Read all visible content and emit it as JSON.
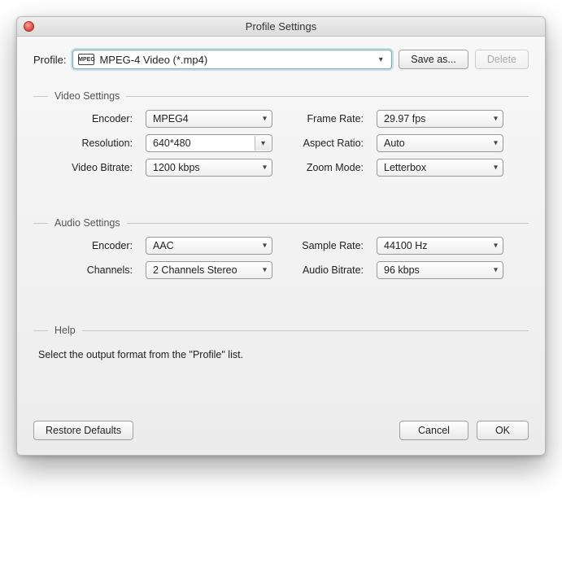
{
  "title": "Profile Settings",
  "profile": {
    "label": "Profile:",
    "icon_text": "MPEG",
    "value": "MPEG-4 Video (*.mp4)",
    "save_as": "Save as...",
    "delete": "Delete"
  },
  "video": {
    "legend": "Video Settings",
    "encoder_label": "Encoder:",
    "encoder": "MPEG4",
    "resolution_label": "Resolution:",
    "resolution": "640*480",
    "bitrate_label": "Video Bitrate:",
    "bitrate": "1200 kbps",
    "framerate_label": "Frame Rate:",
    "framerate": "29.97 fps",
    "aspect_label": "Aspect Ratio:",
    "aspect": "Auto",
    "zoom_label": "Zoom Mode:",
    "zoom": "Letterbox"
  },
  "audio": {
    "legend": "Audio Settings",
    "encoder_label": "Encoder:",
    "encoder": "AAC",
    "channels_label": "Channels:",
    "channels": "2 Channels Stereo",
    "samplerate_label": "Sample Rate:",
    "samplerate": "44100 Hz",
    "bitrate_label": "Audio Bitrate:",
    "bitrate": "96 kbps"
  },
  "help": {
    "legend": "Help",
    "text": "Select the output format from the \"Profile\" list."
  },
  "footer": {
    "restore": "Restore Defaults",
    "cancel": "Cancel",
    "ok": "OK"
  }
}
